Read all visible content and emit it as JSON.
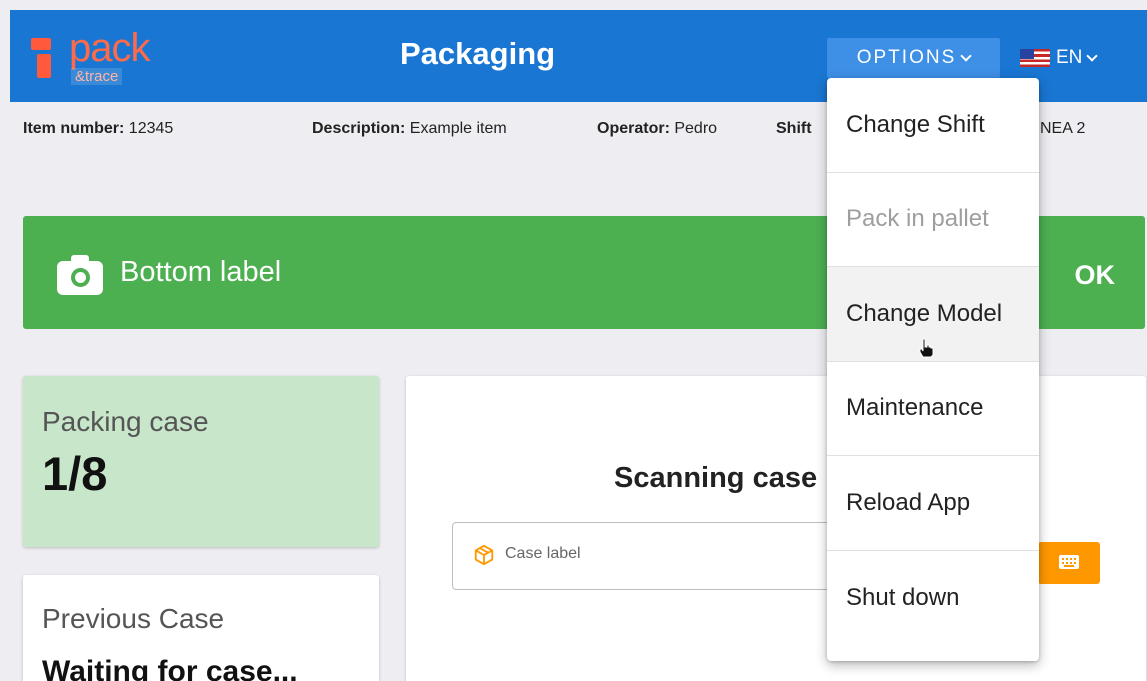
{
  "header": {
    "logo_word": "pack",
    "logo_sub": "&trace",
    "title": "Packaging",
    "options_label": "OPTIONS",
    "language": "EN"
  },
  "info": {
    "item_number_label": "Item number:",
    "item_number": "12345",
    "description_label": "Description:",
    "description": "Example item",
    "operator_label": "Operator:",
    "operator": "Pedro",
    "shift_label": "Shift",
    "line_fragment": "NEA 2"
  },
  "banner": {
    "label": "Bottom label",
    "status": "OK",
    "color": "#4caf50"
  },
  "packing_case": {
    "title": "Packing case",
    "value": "1/8"
  },
  "previous_case": {
    "title": "Previous Case",
    "value": "Waiting for case..."
  },
  "scan": {
    "title": "Scanning case",
    "placeholder": "Case label"
  },
  "options_menu": {
    "items": [
      {
        "label": "Change Shift",
        "enabled": true
      },
      {
        "label": "Pack in pallet",
        "enabled": false
      },
      {
        "label": "Change Model",
        "enabled": true,
        "hovered": true
      },
      {
        "label": "Maintenance",
        "enabled": true
      },
      {
        "label": "Reload App",
        "enabled": true
      },
      {
        "label": "Shut down",
        "enabled": true
      }
    ]
  },
  "colors": {
    "header": "#1976d2",
    "accent_orange": "#ff9800",
    "case_card": "#c8e6c9"
  },
  "icons": {
    "camera": "camera-icon",
    "box": "box-icon",
    "keyboard": "keyboard-icon",
    "flag": "us-flag-icon"
  }
}
